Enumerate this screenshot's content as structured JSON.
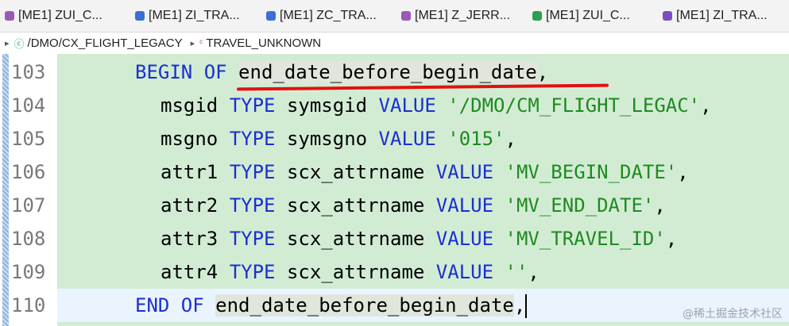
{
  "tabs": [
    {
      "label": "[ME1] ZUI_C...",
      "icon": "behavior-icon",
      "color": "#9b59b6"
    },
    {
      "label": "[ME1] ZI_TRA...",
      "icon": "ddl-icon",
      "color": "#3b6fd4"
    },
    {
      "label": "[ME1] ZC_TRA...",
      "icon": "ddl-icon",
      "color": "#3b6fd4"
    },
    {
      "label": "[ME1] Z_JERR...",
      "icon": "behavior-icon",
      "color": "#9b59b6"
    },
    {
      "label": "[ME1] ZUI_C...",
      "icon": "service-icon",
      "color": "#2e9e4f"
    },
    {
      "label": "[ME1] ZI_TRA...",
      "icon": "behavior-def-icon",
      "color": "#7b4fc4"
    }
  ],
  "breadcrumb": {
    "class_name": "/DMO/CX_FLIGHT_LEGACY",
    "member_name": "TRAVEL_UNKNOWN"
  },
  "lines": [
    {
      "no": "103",
      "tokens": [
        [
          "BEGIN OF ",
          "kw"
        ],
        [
          "end_date_before_begin_date",
          "hl"
        ],
        [
          ",",
          ""
        ]
      ],
      "indent": 4
    },
    {
      "no": "104",
      "tokens": [
        [
          "msgid ",
          ""
        ],
        [
          "TYPE ",
          "kw"
        ],
        [
          "symsgid ",
          ""
        ],
        [
          "VALUE ",
          "kw"
        ],
        [
          "'/DMO/CM_FLIGHT_LEGAC'",
          "str"
        ],
        [
          ",",
          ""
        ]
      ],
      "indent": 5
    },
    {
      "no": "105",
      "tokens": [
        [
          "msgno ",
          ""
        ],
        [
          "TYPE ",
          "kw"
        ],
        [
          "symsgno ",
          ""
        ],
        [
          "VALUE ",
          "kw"
        ],
        [
          "'015'",
          "str"
        ],
        [
          ",",
          ""
        ]
      ],
      "indent": 5
    },
    {
      "no": "106",
      "tokens": [
        [
          "attr1 ",
          ""
        ],
        [
          "TYPE ",
          "kw"
        ],
        [
          "scx_attrname ",
          ""
        ],
        [
          "VALUE ",
          "kw"
        ],
        [
          "'MV_BEGIN_DATE'",
          "str"
        ],
        [
          ",",
          ""
        ]
      ],
      "indent": 5
    },
    {
      "no": "107",
      "tokens": [
        [
          "attr2 ",
          ""
        ],
        [
          "TYPE ",
          "kw"
        ],
        [
          "scx_attrname ",
          ""
        ],
        [
          "VALUE ",
          "kw"
        ],
        [
          "'MV_END_DATE'",
          "str"
        ],
        [
          ",",
          ""
        ]
      ],
      "indent": 5
    },
    {
      "no": "108",
      "tokens": [
        [
          "attr3 ",
          ""
        ],
        [
          "TYPE ",
          "kw"
        ],
        [
          "scx_attrname ",
          ""
        ],
        [
          "VALUE ",
          "kw"
        ],
        [
          "'MV_TRAVEL_ID'",
          "str"
        ],
        [
          ",",
          ""
        ]
      ],
      "indent": 5
    },
    {
      "no": "109",
      "tokens": [
        [
          "attr4 ",
          ""
        ],
        [
          "TYPE ",
          "kw"
        ],
        [
          "scx_attrname ",
          ""
        ],
        [
          "VALUE ",
          "kw"
        ],
        [
          "''",
          "str"
        ],
        [
          ",",
          ""
        ]
      ],
      "indent": 5
    },
    {
      "no": "110",
      "tokens": [
        [
          "END OF ",
          "kw"
        ],
        [
          "end_date_before_begin_date",
          "hl"
        ],
        [
          ",",
          ""
        ]
      ],
      "indent": 4,
      "current": true
    }
  ],
  "watermark": "@稀土掘金技术社区",
  "colors": {
    "keyword": "#1a2fd0",
    "string": "#1f8a1f",
    "editor_bg": "#d2ecd4",
    "underline": "#e31010"
  }
}
